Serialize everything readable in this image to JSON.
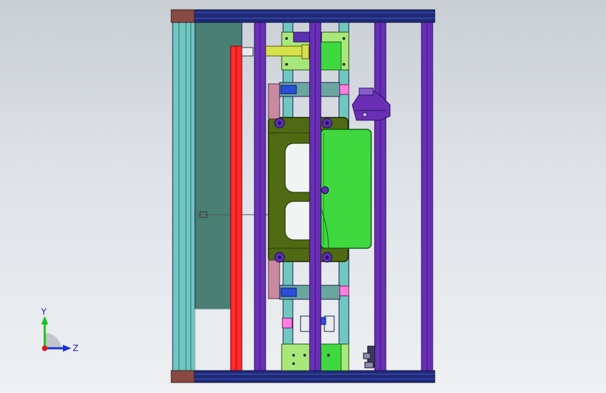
{
  "viewport": {
    "background_top": "#c9ced5",
    "background_bottom": "#eef0f2"
  },
  "model": {
    "colors": {
      "frame_outline": "#1a1a55",
      "rail_navy": "#1f2a78",
      "end_block": "#8a4a44",
      "guide_teal": "#6fc7c0",
      "dark_plate": "#4a7f73",
      "red_bar": "#ff2a2a",
      "purple_rod": "#6a2fb5",
      "olive_core": "#4f6a12",
      "green_block": "#3fd93f",
      "lime_plate": "#a8e87a",
      "pink_marker": "#ff7fe0",
      "yellow_part": "#d6e04a",
      "blue_part": "#2a4fd8"
    }
  },
  "triad": {
    "y_label": "Y",
    "z_label": "Z",
    "y_color": "#16c316",
    "z_color": "#1a33d9",
    "origin_color": "#d61a1a"
  }
}
